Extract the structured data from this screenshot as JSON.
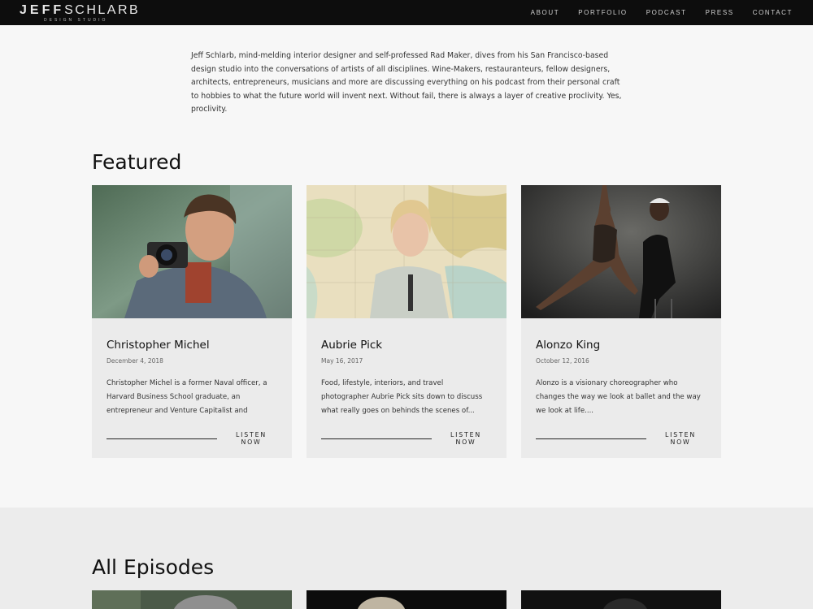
{
  "header": {
    "logo_main_bold": "JEFF",
    "logo_main_thin": "SCHLARB",
    "logo_sub": "DESIGN STUDIO",
    "nav": [
      "ABOUT",
      "PORTFOLIO",
      "PODCAST",
      "PRESS",
      "CONTACT"
    ]
  },
  "intro": "Jeff Schlarb, mind-melding interior designer and self-professed Rad Maker, dives from his San Francisco-based design studio into the conversations of artists of all disciplines. Wine-Makers, restauranteurs, fellow designers, architects, entrepreneurs, musicians and more are discussing everything on his podcast from their personal craft to hobbies to what the future world will invent next. Without fail, there is always a layer of creative proclivity. Yes, proclivity.",
  "featured": {
    "title": "Featured",
    "cards": [
      {
        "name": "Christopher Michel",
        "date": "December 4, 2018",
        "desc": "Christopher Michel is a former Naval officer, a Harvard Business School graduate, an entrepreneur and Venture Capitalist and now...an",
        "cta": "LISTEN NOW"
      },
      {
        "name": "Aubrie Pick",
        "date": "May 16, 2017",
        "desc": "Food, lifestyle, interiors, and travel photographer Aubrie Pick sits down to discuss what really goes on behinds the scenes of...",
        "cta": "LISTEN NOW"
      },
      {
        "name": "Alonzo King",
        "date": "October 12, 2016",
        "desc": "Alonzo is a visionary choreographer who changes the way we look at ballet and the way we look at life....",
        "cta": "LISTEN NOW"
      }
    ]
  },
  "episodes": {
    "title": "All Episodes"
  }
}
